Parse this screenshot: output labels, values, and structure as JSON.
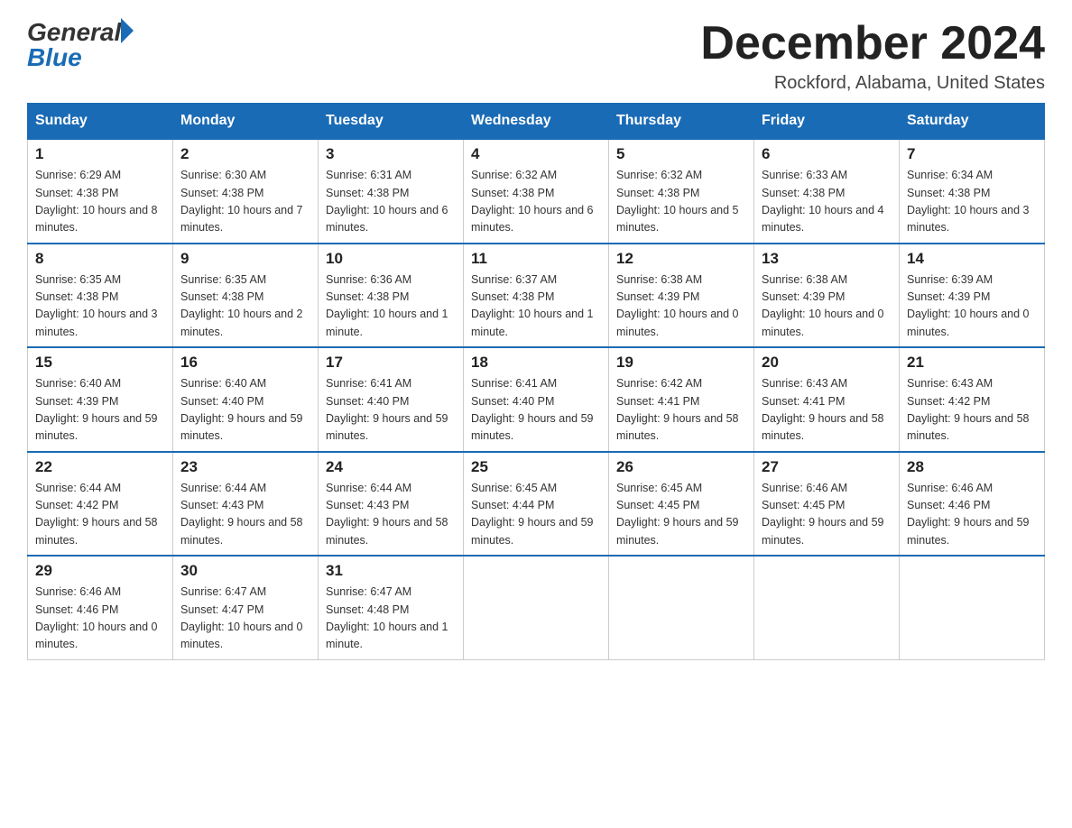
{
  "logo": {
    "text_general": "General",
    "text_blue": "Blue"
  },
  "title": {
    "month_year": "December 2024",
    "location": "Rockford, Alabama, United States"
  },
  "weekdays": [
    "Sunday",
    "Monday",
    "Tuesday",
    "Wednesday",
    "Thursday",
    "Friday",
    "Saturday"
  ],
  "weeks": [
    [
      {
        "day": "1",
        "sunrise": "6:29 AM",
        "sunset": "4:38 PM",
        "daylight": "10 hours and 8 minutes."
      },
      {
        "day": "2",
        "sunrise": "6:30 AM",
        "sunset": "4:38 PM",
        "daylight": "10 hours and 7 minutes."
      },
      {
        "day": "3",
        "sunrise": "6:31 AM",
        "sunset": "4:38 PM",
        "daylight": "10 hours and 6 minutes."
      },
      {
        "day": "4",
        "sunrise": "6:32 AM",
        "sunset": "4:38 PM",
        "daylight": "10 hours and 6 minutes."
      },
      {
        "day": "5",
        "sunrise": "6:32 AM",
        "sunset": "4:38 PM",
        "daylight": "10 hours and 5 minutes."
      },
      {
        "day": "6",
        "sunrise": "6:33 AM",
        "sunset": "4:38 PM",
        "daylight": "10 hours and 4 minutes."
      },
      {
        "day": "7",
        "sunrise": "6:34 AM",
        "sunset": "4:38 PM",
        "daylight": "10 hours and 3 minutes."
      }
    ],
    [
      {
        "day": "8",
        "sunrise": "6:35 AM",
        "sunset": "4:38 PM",
        "daylight": "10 hours and 3 minutes."
      },
      {
        "day": "9",
        "sunrise": "6:35 AM",
        "sunset": "4:38 PM",
        "daylight": "10 hours and 2 minutes."
      },
      {
        "day": "10",
        "sunrise": "6:36 AM",
        "sunset": "4:38 PM",
        "daylight": "10 hours and 1 minute."
      },
      {
        "day": "11",
        "sunrise": "6:37 AM",
        "sunset": "4:38 PM",
        "daylight": "10 hours and 1 minute."
      },
      {
        "day": "12",
        "sunrise": "6:38 AM",
        "sunset": "4:39 PM",
        "daylight": "10 hours and 0 minutes."
      },
      {
        "day": "13",
        "sunrise": "6:38 AM",
        "sunset": "4:39 PM",
        "daylight": "10 hours and 0 minutes."
      },
      {
        "day": "14",
        "sunrise": "6:39 AM",
        "sunset": "4:39 PM",
        "daylight": "10 hours and 0 minutes."
      }
    ],
    [
      {
        "day": "15",
        "sunrise": "6:40 AM",
        "sunset": "4:39 PM",
        "daylight": "9 hours and 59 minutes."
      },
      {
        "day": "16",
        "sunrise": "6:40 AM",
        "sunset": "4:40 PM",
        "daylight": "9 hours and 59 minutes."
      },
      {
        "day": "17",
        "sunrise": "6:41 AM",
        "sunset": "4:40 PM",
        "daylight": "9 hours and 59 minutes."
      },
      {
        "day": "18",
        "sunrise": "6:41 AM",
        "sunset": "4:40 PM",
        "daylight": "9 hours and 59 minutes."
      },
      {
        "day": "19",
        "sunrise": "6:42 AM",
        "sunset": "4:41 PM",
        "daylight": "9 hours and 58 minutes."
      },
      {
        "day": "20",
        "sunrise": "6:43 AM",
        "sunset": "4:41 PM",
        "daylight": "9 hours and 58 minutes."
      },
      {
        "day": "21",
        "sunrise": "6:43 AM",
        "sunset": "4:42 PM",
        "daylight": "9 hours and 58 minutes."
      }
    ],
    [
      {
        "day": "22",
        "sunrise": "6:44 AM",
        "sunset": "4:42 PM",
        "daylight": "9 hours and 58 minutes."
      },
      {
        "day": "23",
        "sunrise": "6:44 AM",
        "sunset": "4:43 PM",
        "daylight": "9 hours and 58 minutes."
      },
      {
        "day": "24",
        "sunrise": "6:44 AM",
        "sunset": "4:43 PM",
        "daylight": "9 hours and 58 minutes."
      },
      {
        "day": "25",
        "sunrise": "6:45 AM",
        "sunset": "4:44 PM",
        "daylight": "9 hours and 59 minutes."
      },
      {
        "day": "26",
        "sunrise": "6:45 AM",
        "sunset": "4:45 PM",
        "daylight": "9 hours and 59 minutes."
      },
      {
        "day": "27",
        "sunrise": "6:46 AM",
        "sunset": "4:45 PM",
        "daylight": "9 hours and 59 minutes."
      },
      {
        "day": "28",
        "sunrise": "6:46 AM",
        "sunset": "4:46 PM",
        "daylight": "9 hours and 59 minutes."
      }
    ],
    [
      {
        "day": "29",
        "sunrise": "6:46 AM",
        "sunset": "4:46 PM",
        "daylight": "10 hours and 0 minutes."
      },
      {
        "day": "30",
        "sunrise": "6:47 AM",
        "sunset": "4:47 PM",
        "daylight": "10 hours and 0 minutes."
      },
      {
        "day": "31",
        "sunrise": "6:47 AM",
        "sunset": "4:48 PM",
        "daylight": "10 hours and 1 minute."
      },
      null,
      null,
      null,
      null
    ]
  ]
}
